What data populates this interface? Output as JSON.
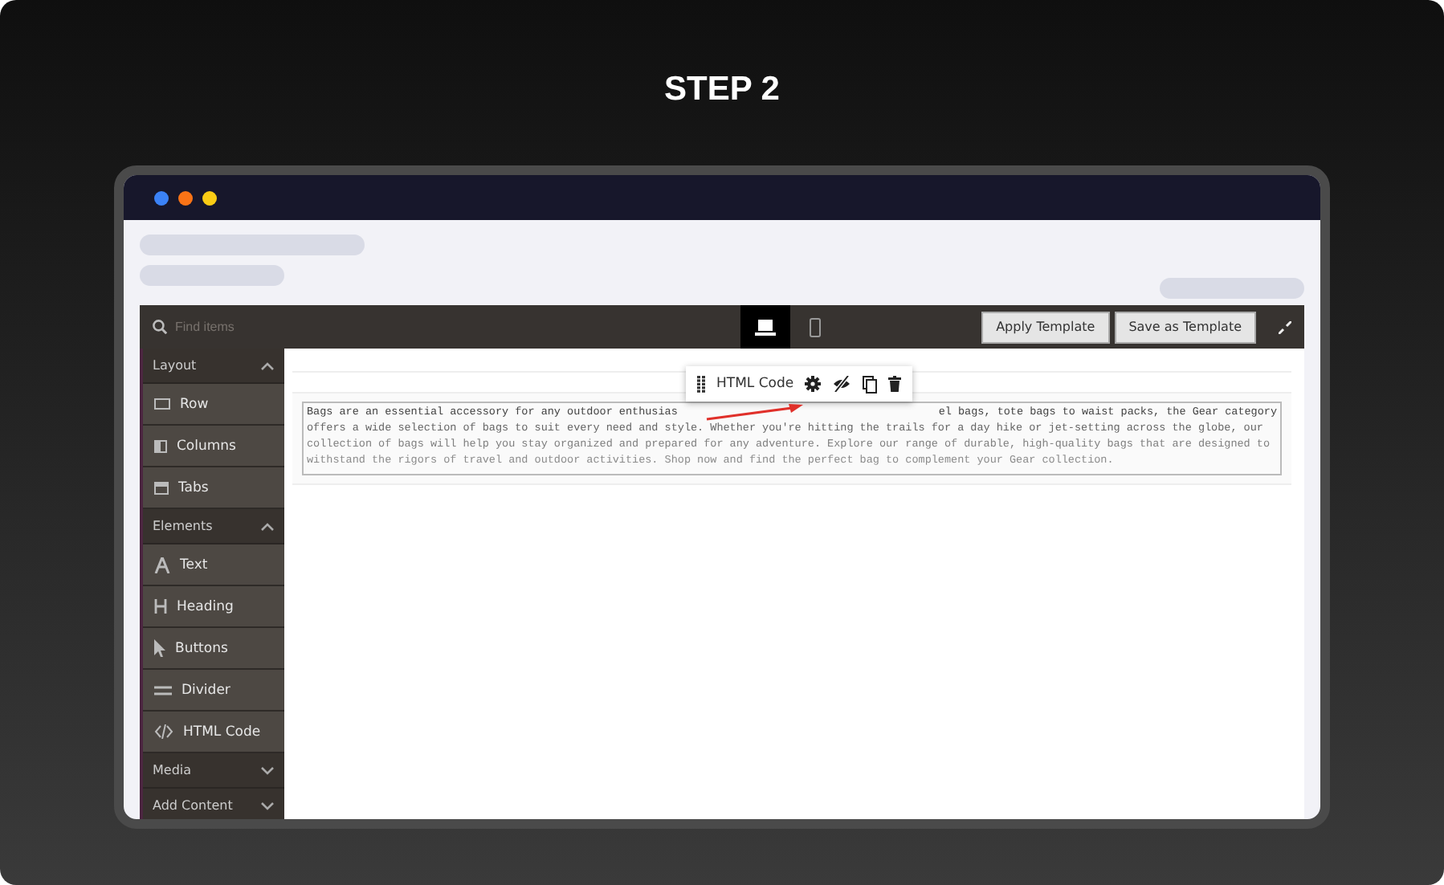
{
  "heading": "STEP 2",
  "editor": {
    "search": {
      "placeholder": "Find items"
    },
    "devices": [
      {
        "kind": "desktop",
        "selected": true
      },
      {
        "kind": "mobile",
        "selected": false
      }
    ],
    "buttons": [
      "Apply Template",
      "Save as Template"
    ],
    "sidebar": [
      {
        "title": "Layout",
        "expanded": true,
        "items": [
          {
            "kind": "row",
            "label": "Row"
          },
          {
            "kind": "columns",
            "label": "Columns"
          },
          {
            "kind": "tabs",
            "label": "Tabs"
          }
        ]
      },
      {
        "title": "Elements",
        "expanded": true,
        "items": [
          {
            "kind": "text",
            "label": "Text"
          },
          {
            "kind": "heading",
            "label": "Heading"
          },
          {
            "kind": "buttons",
            "label": "Buttons"
          },
          {
            "kind": "divider",
            "label": "Divider"
          },
          {
            "kind": "html",
            "label": "HTML Code"
          }
        ]
      },
      {
        "title": "Media",
        "expanded": false
      },
      {
        "title": "Add Content",
        "expanded": false
      }
    ],
    "toolbar": {
      "label": "HTML Code"
    },
    "content_lines": [
      [
        "Bags are an essential accessory for any outdoor enthusias",
        "el bags, tote bags to waist packs, the Gear category"
      ],
      [
        "offers a wide selection of bags to suit every need and style. Whether you're hitting the trails for a day hike or jet-setting across the globe, our"
      ],
      [
        "collection of bags will help you stay organized and prepared for any adventure. Explore our range of durable, high-quality bags that are designed to"
      ],
      [
        "withstand the rigors of travel and outdoor activities. Shop now and find the perfect bag to complement your Gear collection."
      ]
    ]
  }
}
